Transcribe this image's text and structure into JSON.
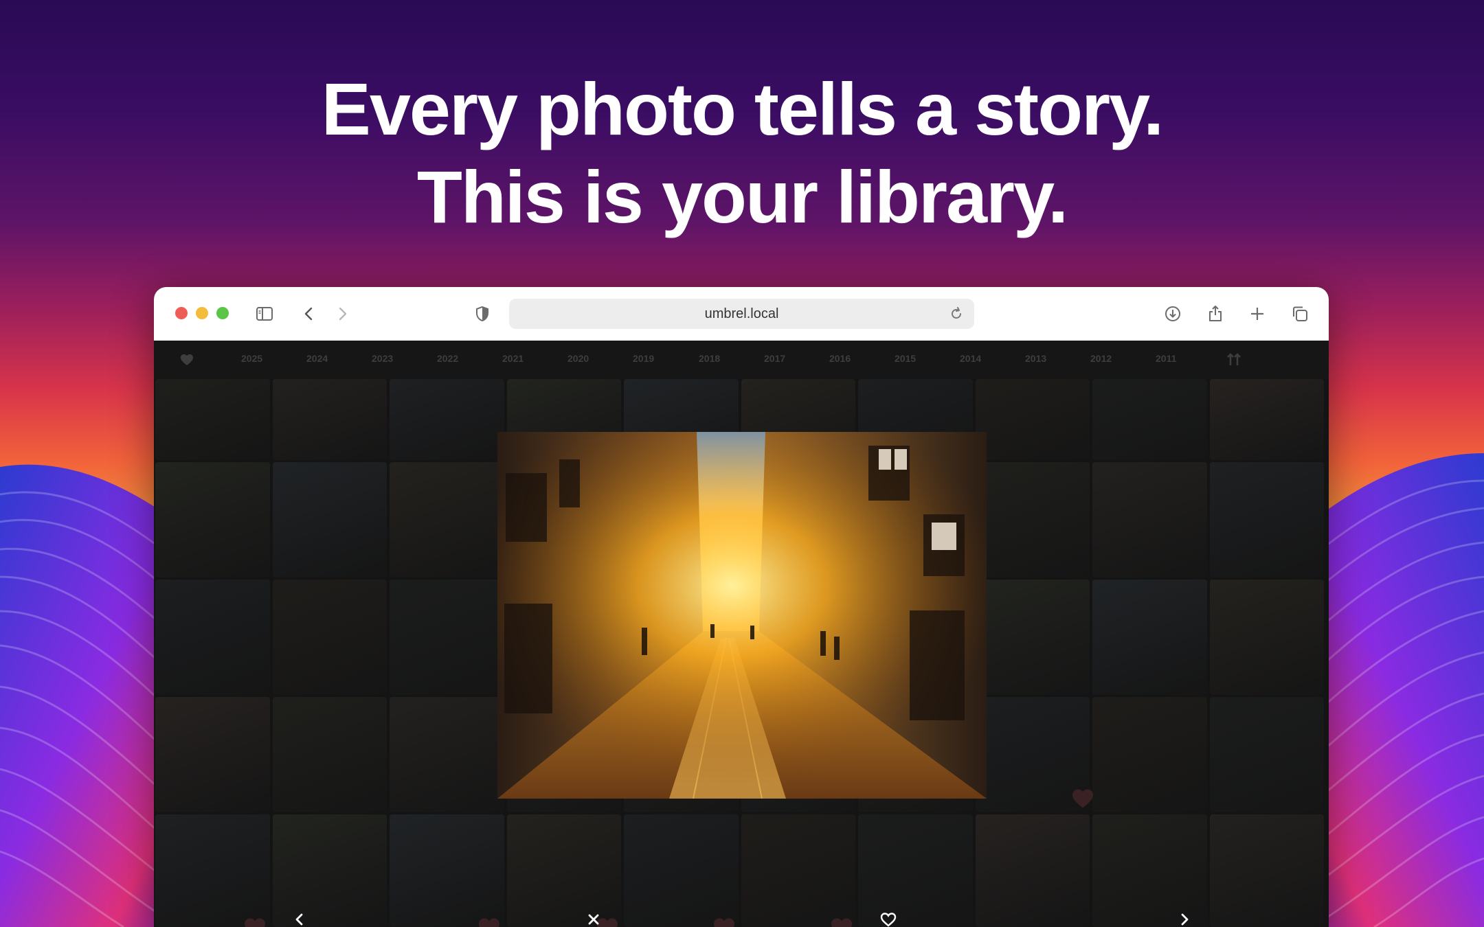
{
  "headline": {
    "line1": "Every photo tells a story.",
    "line2": "This is your library."
  },
  "browser": {
    "url": "umbrel.local",
    "toolbar_icons": [
      "sidebar-icon",
      "back-icon",
      "forward-icon",
      "shield-icon",
      "reload-icon",
      "download-icon",
      "share-icon",
      "new-tab-icon",
      "tabs-overview-icon"
    ]
  },
  "timeline": {
    "favorites_icon": "heart-icon",
    "years": [
      "2025",
      "2024",
      "2023",
      "2022",
      "2021",
      "2020",
      "2019",
      "2018",
      "2017",
      "2016",
      "2015",
      "2014",
      "2013",
      "2012",
      "2011"
    ],
    "sort_icon": "sort-arrows-icon"
  },
  "viewer": {
    "photo_icon": "street-sunset-photo",
    "controls": [
      "previous-icon",
      "close-icon",
      "favorite-icon",
      "next-icon"
    ]
  },
  "colors": {
    "accent": "#ffffff",
    "window_bg": "#141414",
    "toolbar_bg": "#ffffff"
  }
}
